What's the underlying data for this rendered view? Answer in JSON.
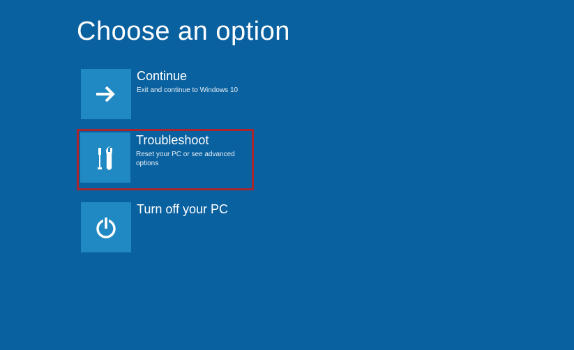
{
  "page": {
    "title": "Choose an option"
  },
  "options": {
    "continue": {
      "title": "Continue",
      "subtitle": "Exit and continue to Windows 10"
    },
    "troubleshoot": {
      "title": "Troubleshoot",
      "subtitle": "Reset your PC or see advanced options"
    },
    "turnoff": {
      "title": "Turn off your PC",
      "subtitle": ""
    }
  },
  "colors": {
    "background": "#0a61a0",
    "tile": "#2088c2",
    "highlight_border": "#a8252e"
  }
}
